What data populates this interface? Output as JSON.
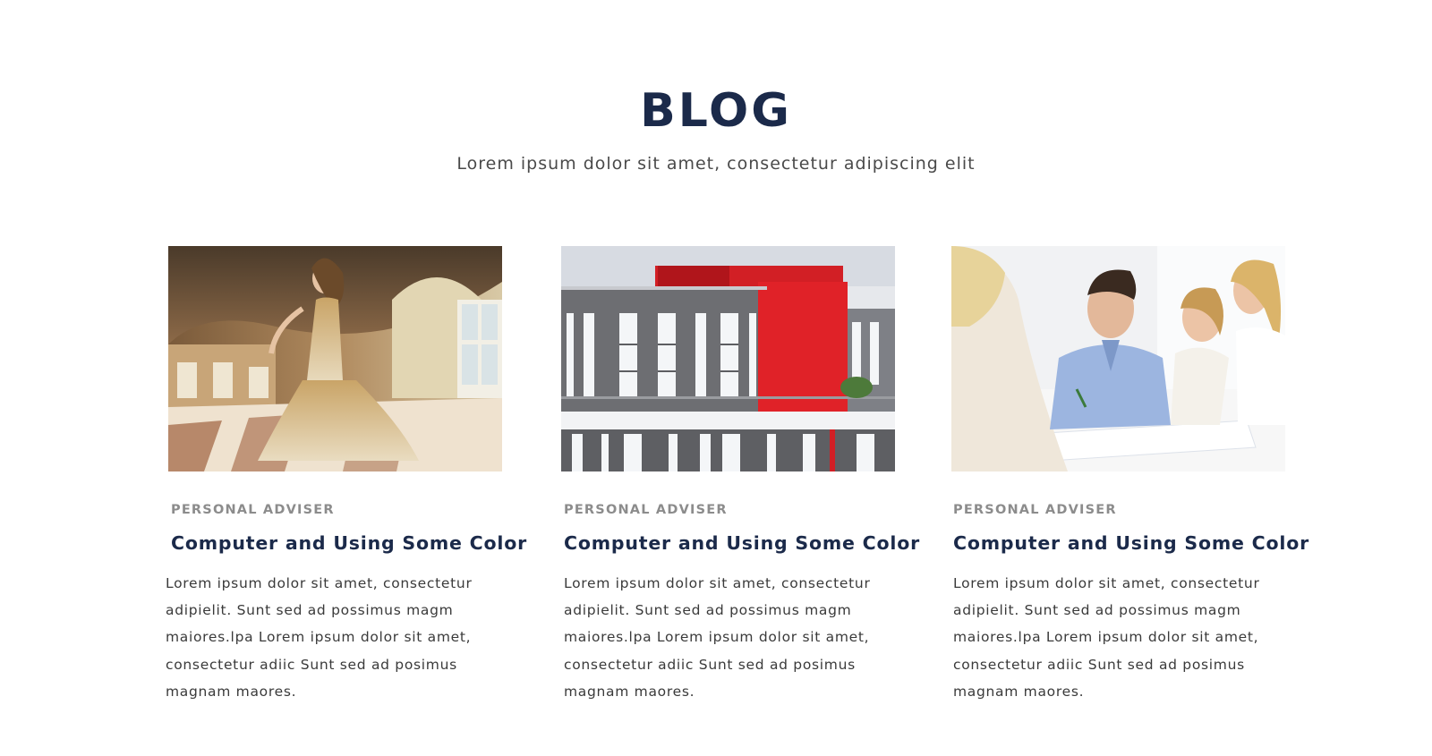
{
  "section": {
    "title": "BLOG",
    "subtitle": "Lorem ipsum dolor sit amet, consectetur adipiscing elit"
  },
  "posts": [
    {
      "image": "woman-in-gold-gown-in-baroque-hall",
      "category": "PERSONAL ADVISER",
      "title": "Computer and Using Some Color",
      "excerpt": "Lorem ipsum dolor sit amet, consectetur adipielit. Sunt sed ad possimus magm maiores.lpa Lorem ipsum dolor sit amet, consectetur adiic Sunt sed ad posimus magnam maores."
    },
    {
      "image": "modern-building-with-red-facade",
      "category": "PERSONAL ADVISER",
      "title": "Computer and Using Some Color",
      "excerpt": "Lorem ipsum dolor sit amet, consectetur adipielit. Sunt sed ad possimus magm maiores.lpa Lorem ipsum dolor sit amet, consectetur adiic Sunt sed ad posimus magnam maores."
    },
    {
      "image": "family-signing-documents-with-adviser",
      "category": "PERSONAL ADVISER",
      "title": "Computer and Using Some Color",
      "excerpt": "Lorem ipsum dolor sit amet, consectetur adipielit. Sunt sed ad possimus magm maiores.lpa Lorem ipsum dolor sit amet, consectetur adiic Sunt sed ad posimus magnam maores."
    }
  ],
  "colors": {
    "heading": "#1b2a4a",
    "category": "#8c8c8c",
    "body_text": "#3a3a3a",
    "background": "#ffffff"
  }
}
